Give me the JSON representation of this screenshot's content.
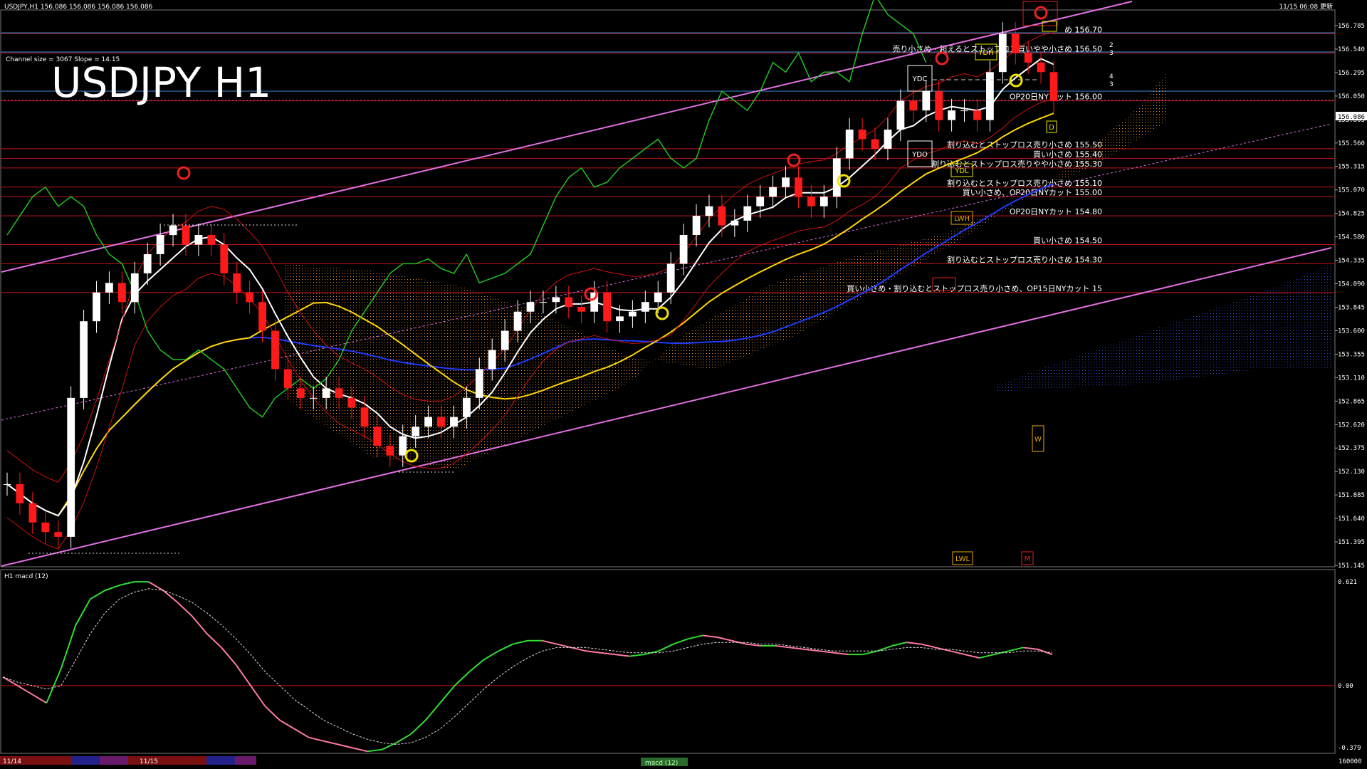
{
  "header": {
    "symbol_ohlc": "USDJPY,H1  156.086 156.086 156.086 156.086",
    "datetime": "11/15 06:08 更新"
  },
  "main_title": "USDJPY H1",
  "channel_info": "Channel size = 3067 Slope = 14.15",
  "current_price": "156.086",
  "colors": {
    "background": "#000000",
    "bull_candle": "#ffffff",
    "bear_candle": "#ff1a1a",
    "channel": "#e070e0",
    "ma_fast": "#ffffff",
    "ma_mid": "#ffd700",
    "ma_slow": "#1e3cff",
    "chikou": "#22c322",
    "level_line": "#c01818",
    "macd_up": "#33dd33",
    "macd_down": "#ff7aa8",
    "cloud": "#ff9933",
    "cloud_blue": "#3355dd"
  },
  "price_axis": {
    "labels": [
      "156.785",
      "156.540",
      "156.295",
      "156.050",
      "155.805",
      "155.560",
      "155.315",
      "155.070",
      "154.825",
      "154.580",
      "154.335",
      "154.090",
      "153.845",
      "153.600",
      "153.355",
      "153.110",
      "152.865",
      "152.620",
      "152.375",
      "152.130",
      "151.885",
      "151.640",
      "151.395",
      "151.145"
    ]
  },
  "macd_axis": {
    "title": "H1  macd (12)",
    "labels": [
      "0.621",
      "0.00",
      "-0.379"
    ]
  },
  "levels": [
    {
      "text": "売り小さめ・超えるとストップロス買いやや小さめ 156.50",
      "price": 156.5
    },
    {
      "text": "め 156.70",
      "price": 156.7
    },
    {
      "text": "OP20日NYカット 156.00",
      "price": 156.0
    },
    {
      "text": "割り込むとストップロス売り小さめ 155.50",
      "price": 155.5
    },
    {
      "text": "買い小さめ 155.40",
      "price": 155.4
    },
    {
      "text": "割り込むとストップロス売りやや小さめ 155.30",
      "price": 155.3
    },
    {
      "text": "割り込むとストップロス売り小さめ 155.10",
      "price": 155.1
    },
    {
      "text": "買い小さめ、OP20日NYカット 155.00",
      "price": 155.0
    },
    {
      "text": "OP20日NYカット 154.80",
      "price": 154.8
    },
    {
      "text": "買い小さめ 154.50",
      "price": 154.5
    },
    {
      "text": "割り込むとストップロス売り小さめ 154.30",
      "price": 154.3
    },
    {
      "text": "買い小さめ・割り込むとストップロス売り小さめ、OP15日NYカット 15",
      "price": 154.0
    }
  ],
  "markers": {
    "ydh": "YDH",
    "ydc": "YDC",
    "ydo": "YDO",
    "ydl": "YDL",
    "lwh": "LWH",
    "lwl": "LWL",
    "w": "W",
    "m": "M",
    "d": "D",
    "sma_nums": [
      "2",
      "3",
      "4",
      "3"
    ]
  },
  "bottom_bar": {
    "date1": "11/14",
    "date2": "11/15",
    "tab": "macd (12)",
    "right": "160000"
  },
  "chart_data": {
    "type": "candlestick",
    "title": "USDJPY H1",
    "ylim": [
      151.145,
      156.785
    ],
    "closes": [
      152.0,
      151.8,
      151.6,
      151.5,
      151.45,
      152.9,
      153.7,
      154.0,
      154.1,
      153.9,
      154.2,
      154.4,
      154.6,
      154.7,
      154.5,
      154.6,
      154.5,
      154.2,
      154.0,
      153.9,
      153.6,
      153.2,
      153.0,
      152.9,
      152.9,
      153.0,
      152.9,
      152.8,
      152.6,
      152.4,
      152.3,
      152.5,
      152.6,
      152.7,
      152.6,
      152.7,
      152.9,
      153.2,
      153.4,
      153.6,
      153.8,
      153.9,
      153.9,
      153.95,
      153.85,
      153.8,
      154.0,
      153.7,
      153.75,
      153.8,
      153.9,
      154.0,
      154.3,
      154.6,
      154.8,
      154.9,
      154.7,
      154.75,
      154.9,
      155.0,
      155.1,
      155.2,
      155.0,
      154.9,
      155.0,
      155.4,
      155.7,
      155.6,
      155.5,
      155.7,
      156.0,
      155.9,
      156.1,
      155.8,
      155.9,
      155.9,
      155.8,
      156.3,
      156.7,
      156.5,
      156.4,
      156.3,
      156.0
    ],
    "macd": {
      "main": [
        0.05,
        0.0,
        -0.05,
        -0.1,
        0.1,
        0.35,
        0.5,
        0.55,
        0.58,
        0.6,
        0.6,
        0.55,
        0.48,
        0.4,
        0.3,
        0.22,
        0.12,
        0.0,
        -0.12,
        -0.2,
        -0.25,
        -0.3,
        -0.32,
        -0.34,
        -0.36,
        -0.38,
        -0.37,
        -0.33,
        -0.28,
        -0.2,
        -0.1,
        0.0,
        0.08,
        0.15,
        0.2,
        0.24,
        0.26,
        0.26,
        0.24,
        0.22,
        0.2,
        0.19,
        0.18,
        0.17,
        0.18,
        0.2,
        0.24,
        0.27,
        0.29,
        0.28,
        0.26,
        0.24,
        0.23,
        0.23,
        0.22,
        0.21,
        0.2,
        0.19,
        0.18,
        0.18,
        0.2,
        0.23,
        0.25,
        0.24,
        0.22,
        0.2,
        0.18,
        0.16,
        0.18,
        0.2,
        0.22,
        0.21,
        0.18
      ],
      "signal": [
        0.05,
        0.02,
        0.0,
        -0.02,
        0.0,
        0.15,
        0.3,
        0.42,
        0.5,
        0.54,
        0.56,
        0.55,
        0.52,
        0.48,
        0.42,
        0.35,
        0.27,
        0.18,
        0.08,
        0.0,
        -0.08,
        -0.14,
        -0.2,
        -0.24,
        -0.28,
        -0.31,
        -0.33,
        -0.34,
        -0.33,
        -0.3,
        -0.25,
        -0.18,
        -0.1,
        -0.02,
        0.05,
        0.11,
        0.16,
        0.2,
        0.22,
        0.22,
        0.22,
        0.21,
        0.2,
        0.19,
        0.19,
        0.19,
        0.2,
        0.22,
        0.24,
        0.25,
        0.25,
        0.25,
        0.24,
        0.24,
        0.23,
        0.22,
        0.21,
        0.2,
        0.2,
        0.2,
        0.2,
        0.21,
        0.22,
        0.22,
        0.21,
        0.21,
        0.2,
        0.19,
        0.19,
        0.19,
        0.2,
        0.2,
        0.19
      ]
    }
  }
}
